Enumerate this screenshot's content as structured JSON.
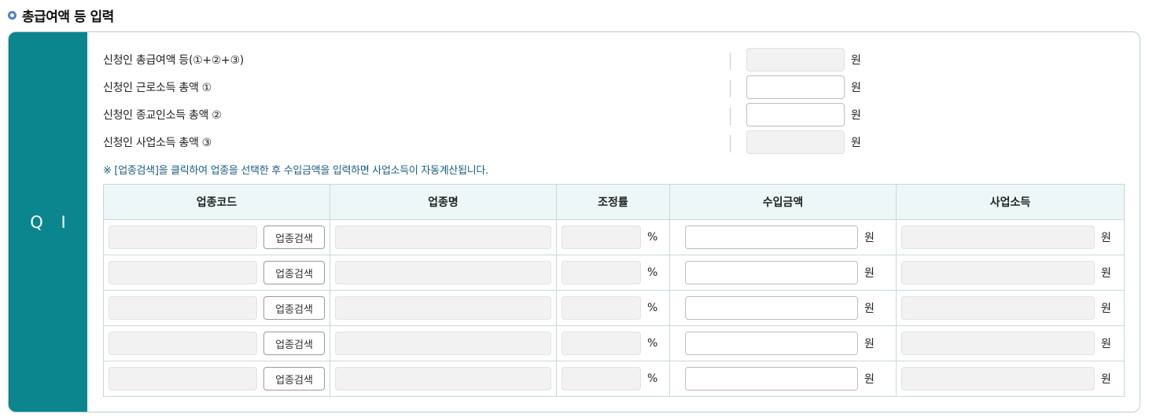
{
  "section": {
    "title": "총급여액 등 입력"
  },
  "panel": {
    "label": "Q I"
  },
  "summary": [
    {
      "label": "신청인 총급여액 등(①+②+③)",
      "unit": "원",
      "readonly": true
    },
    {
      "label": "신청인 근로소득 총액 ①",
      "unit": "원",
      "readonly": false
    },
    {
      "label": "신청인 종교인소득 총액 ②",
      "unit": "원",
      "readonly": false
    },
    {
      "label": "신청인 사업소득 총액 ③",
      "unit": "원",
      "readonly": true
    }
  ],
  "notice": "※ [업종검색]을 클릭하여 업종을 선택한 후 수입금액을 입력하면 사업소득이 자동계산됩니다.",
  "table": {
    "headers": [
      "업종코드",
      "업종명",
      "조정률",
      "수입금액",
      "사업소득"
    ],
    "search_button": "업종검색",
    "percent_unit": "%",
    "won_unit": "원",
    "rows": [
      {
        "code": "",
        "name": "",
        "rate": "",
        "income": "",
        "business_income": ""
      },
      {
        "code": "",
        "name": "",
        "rate": "",
        "income": "",
        "business_income": ""
      },
      {
        "code": "",
        "name": "",
        "rate": "",
        "income": "",
        "business_income": ""
      },
      {
        "code": "",
        "name": "",
        "rate": "",
        "income": "",
        "business_income": ""
      },
      {
        "code": "",
        "name": "",
        "rate": "",
        "income": "",
        "business_income": ""
      }
    ]
  }
}
